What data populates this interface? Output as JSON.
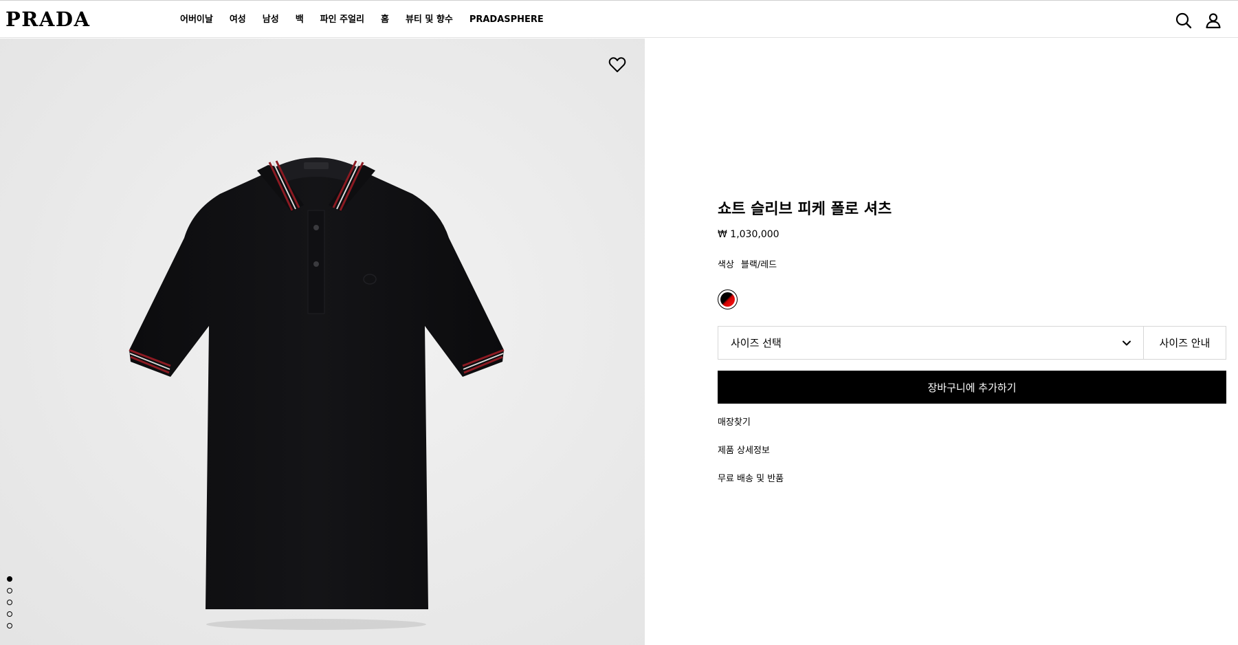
{
  "brand": {
    "logo": "PRADA"
  },
  "nav": {
    "items": [
      "어버이날",
      "여성",
      "남성",
      "백",
      "파인 주얼리",
      "홈",
      "뷰티 및 향수",
      "PRADASPHERE"
    ]
  },
  "header_icons": [
    "search-icon",
    "account-icon"
  ],
  "gallery": {
    "image_count": 5,
    "active_index": 0,
    "wishlist_icon": "heart-icon"
  },
  "product": {
    "title": "쇼트 슬리브 피케 폴로 셔츠",
    "price": "₩ 1,030,000",
    "color_label": "색상",
    "color_value": "블랙/레드",
    "size_select": "사이즈 선택",
    "size_guide": "사이즈 안내",
    "add_to_cart": "장바구니에 추가하기",
    "links": [
      "매장찾기",
      "제품 상세정보",
      "무료 배송 및 반품"
    ]
  },
  "colors": {
    "swatch_primary": "#000000",
    "swatch_secondary": "#e00000",
    "button_bg": "#000000"
  }
}
